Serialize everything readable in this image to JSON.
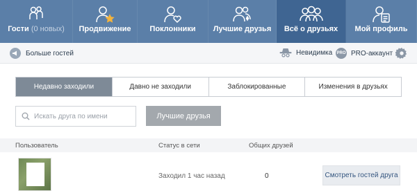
{
  "nav": {
    "items": [
      {
        "label": "Гости",
        "count": "(0 новых)",
        "icon": "guests-icon"
      },
      {
        "label": "Продвижение",
        "icon": "promotion-icon"
      },
      {
        "label": "Поклонники",
        "icon": "admirers-icon"
      },
      {
        "label": "Лучшие друзья",
        "icon": "best-friends-icon"
      },
      {
        "label": "Всё о друзьях",
        "icon": "all-friends-icon"
      },
      {
        "label": "Мой профиль",
        "icon": "profile-icon"
      }
    ],
    "active_index": 4,
    "colors": {
      "bar": "#5b7fa8",
      "active": "#3f6592",
      "star": "#f3b33d"
    }
  },
  "subbar": {
    "more_guests": "Больше гостей",
    "invisible": "Невидимка",
    "pro_badge": "PRO",
    "pro_account": "PRO-аккаунт"
  },
  "tabs": [
    "Недавно заходили",
    "Давно не заходили",
    "Заблокированные",
    "Изменения в друзьях"
  ],
  "active_tab": 0,
  "search": {
    "placeholder": "Искать друга по имени",
    "value": ""
  },
  "best_friends_button": "Лучшие друзья",
  "table": {
    "headers": {
      "user": "Пользователь",
      "status": "Статус в сети",
      "mutual": "Общих друзей"
    },
    "rows": [
      {
        "status": "Заходил 1 час назад",
        "mutual": "0",
        "action": "Смотреть гостей друга"
      }
    ]
  }
}
